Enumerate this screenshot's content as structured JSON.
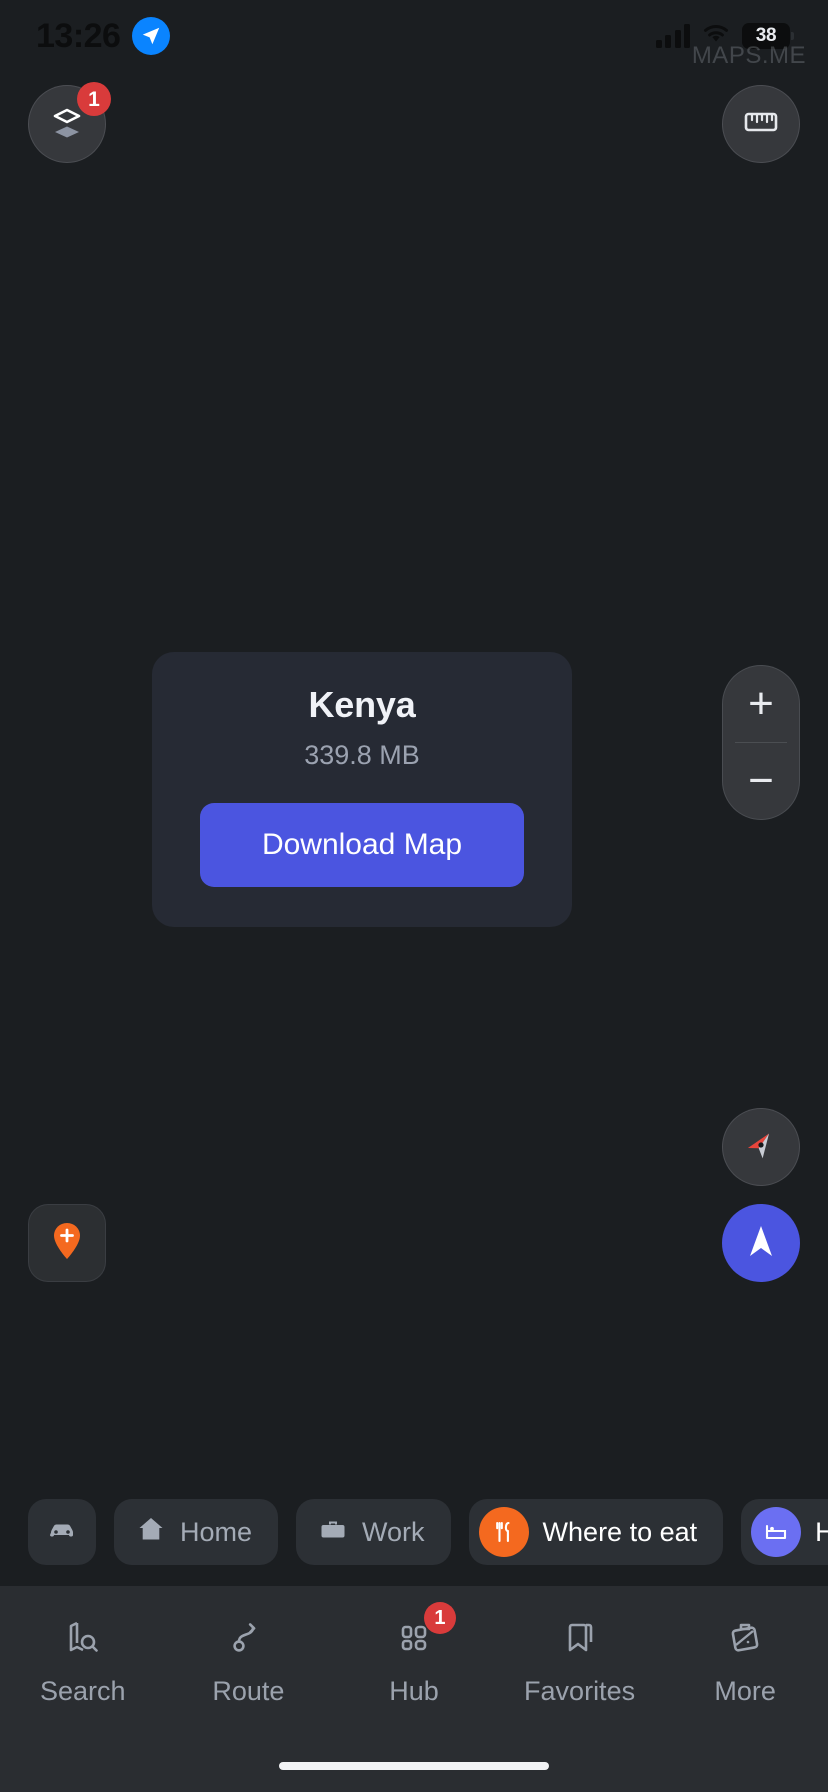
{
  "app": {
    "watermark": "MAPS.ME"
  },
  "status_bar": {
    "time": "13:26",
    "location_icon": "location-arrow-icon",
    "signal_icon": "cellular-signal-icon",
    "wifi_icon": "wifi-icon",
    "battery_percent": "38"
  },
  "map_controls": {
    "layers": {
      "icon": "layers-icon",
      "badge": "1"
    },
    "ruler": {
      "icon": "ruler-icon"
    },
    "zoom_in": {
      "label": "+"
    },
    "zoom_out": {
      "label": "−"
    },
    "compass": {
      "icon": "compass-icon"
    },
    "add_place": {
      "icon": "add-place-pin-icon"
    },
    "my_location": {
      "icon": "navigation-arrow-icon"
    }
  },
  "download_card": {
    "title": "Kenya",
    "size": "339.8 MB",
    "button_label": "Download Map",
    "accent_color": "#4b55e0",
    "background_color": "#262a34"
  },
  "quick_chips": [
    {
      "label": "",
      "icon": "car-icon",
      "style": "icon-only"
    },
    {
      "label": "Home",
      "icon": "home-icon",
      "style": "plain"
    },
    {
      "label": "Work",
      "icon": "briefcase-icon",
      "style": "plain"
    },
    {
      "label": "Where to eat",
      "icon": "restaurant-icon",
      "style": "orange",
      "color": "#f4691f"
    },
    {
      "label": "Hotel",
      "icon": "hotel-bed-icon",
      "style": "purple",
      "color": "#6b6ff2"
    }
  ],
  "tabbar": [
    {
      "label": "Search",
      "icon": "map-search-icon",
      "badge": ""
    },
    {
      "label": "Route",
      "icon": "route-icon",
      "badge": ""
    },
    {
      "label": "Hub",
      "icon": "hub-grid-icon",
      "badge": "1"
    },
    {
      "label": "Favorites",
      "icon": "bookmark-icon",
      "badge": ""
    },
    {
      "label": "More",
      "icon": "more-briefcase-icon",
      "badge": ""
    }
  ],
  "colors": {
    "background": "#1b1e21",
    "tabbar": "#2a2d31",
    "accent": "#4b55e0",
    "badge_red": "#d93b3b",
    "chip_bg": "#2c3035"
  }
}
